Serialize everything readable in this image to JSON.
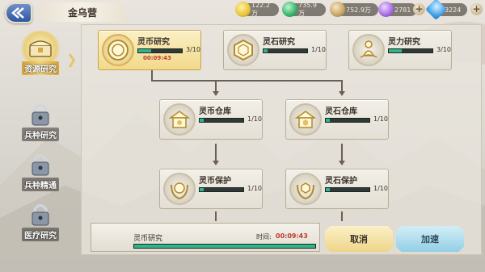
{
  "topbar": {
    "title": "金乌营",
    "back_icon": "back-arrow-icon",
    "resources": [
      {
        "icon": "gold-coin-icon",
        "value": "122.2万",
        "color": "#e8c33a"
      },
      {
        "icon": "green-gem-icon",
        "value": "735.9万",
        "color": "#36b36a"
      },
      {
        "icon": "wheat-icon",
        "value": "752.9万",
        "color": "#c9a464"
      },
      {
        "icon": "purple-orb-icon",
        "value": "2781",
        "color": "#a46be0"
      },
      {
        "icon": "diamond-icon",
        "value": "3224",
        "color": "#4aa7ee"
      }
    ]
  },
  "sidebar": {
    "items": [
      {
        "label": "资源研究",
        "icon": "treasure-chest-icon",
        "locked": false,
        "active": true
      },
      {
        "label": "兵种研究",
        "icon": "lock-icon",
        "locked": true,
        "active": false
      },
      {
        "label": "兵种精通",
        "icon": "lock-icon",
        "locked": true,
        "active": false
      },
      {
        "label": "医疗研究",
        "icon": "lock-icon",
        "locked": true,
        "active": false
      }
    ]
  },
  "tree": {
    "nodes": [
      {
        "name": "灵币研究",
        "level": "3/10",
        "progress": 0.3,
        "timer": "00:09:43",
        "icon": "coin-icon",
        "selected": true
      },
      {
        "name": "灵石研究",
        "level": "1/10",
        "progress": 0.1,
        "timer": "",
        "icon": "hexagon-stone-icon",
        "selected": false
      },
      {
        "name": "灵力研究",
        "level": "3/10",
        "progress": 0.3,
        "timer": "",
        "icon": "meditation-icon",
        "selected": false
      },
      {
        "name": "灵币仓库",
        "level": "1/10",
        "progress": 0.1,
        "timer": "",
        "icon": "coin-warehouse-icon",
        "selected": false
      },
      {
        "name": "灵石仓库",
        "level": "1/10",
        "progress": 0.1,
        "timer": "",
        "icon": "stone-warehouse-icon",
        "selected": false
      },
      {
        "name": "灵币保护",
        "level": "1/10",
        "progress": 0.1,
        "timer": "",
        "icon": "coin-shield-icon",
        "selected": false
      },
      {
        "name": "灵石保护",
        "level": "1/10",
        "progress": 0.1,
        "timer": "",
        "icon": "stone-shield-icon",
        "selected": false
      }
    ]
  },
  "bottom": {
    "research_name": "灵币研究",
    "time_label": "时间:",
    "time_value": "00:09:43",
    "progress": 1.0,
    "cancel_label": "取消",
    "speedup_label": "加速"
  }
}
